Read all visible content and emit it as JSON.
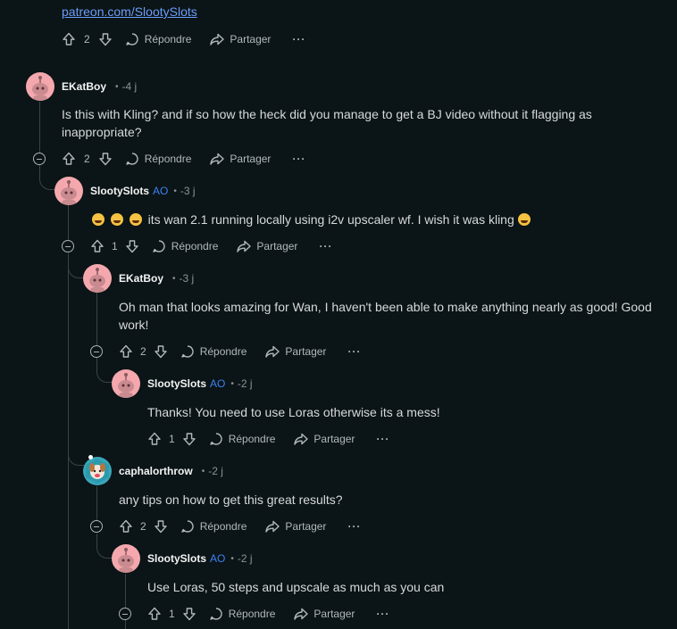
{
  "top": {
    "link": "patreon.com/SlootySlots",
    "votes": "2",
    "reply": "Répondre",
    "share": "Partager"
  },
  "comments": [
    {
      "author": "EKatBoy",
      "ao": "",
      "time": "-4 j",
      "body": "Is this with Kling? and if so how the heck did you manage to get a BJ video without it flagging as inappropriate?",
      "votes": "2",
      "reply": "Répondre",
      "share": "Partager"
    },
    {
      "author": "SlootySlots",
      "ao": "AO",
      "time": "-3 j",
      "body": "its wan 2.1 running locally using i2v upscaler wf. I wish it was kling",
      "votes": "1",
      "reply": "Répondre",
      "share": "Partager"
    },
    {
      "author": "EKatBoy",
      "ao": "",
      "time": "-3 j",
      "body": "Oh man that looks amazing for Wan, I haven't been able to make anything nearly as good! Good work!",
      "votes": "2",
      "reply": "Répondre",
      "share": "Partager"
    },
    {
      "author": "SlootySlots",
      "ao": "AO",
      "time": "-2 j",
      "body": "Thanks! You need to use Loras otherwise its a mess!",
      "votes": "1",
      "reply": "Répondre",
      "share": "Partager"
    },
    {
      "author": "caphalorthrow",
      "ao": "",
      "time": "-2 j",
      "body": "any tips on how to get this great results?",
      "votes": "2",
      "reply": "Répondre",
      "share": "Partager"
    },
    {
      "author": "SlootySlots",
      "ao": "AO",
      "time": "-2 j",
      "body": "Use Loras, 50 steps and upscale as much as you can",
      "votes": "1",
      "reply": "Répondre",
      "share": "Partager"
    }
  ],
  "more_label": "···",
  "colors": {
    "background": "#0b1416",
    "link": "#6b9dfa",
    "ao": "#3b82f6",
    "avatar": "#f4a8ae"
  }
}
